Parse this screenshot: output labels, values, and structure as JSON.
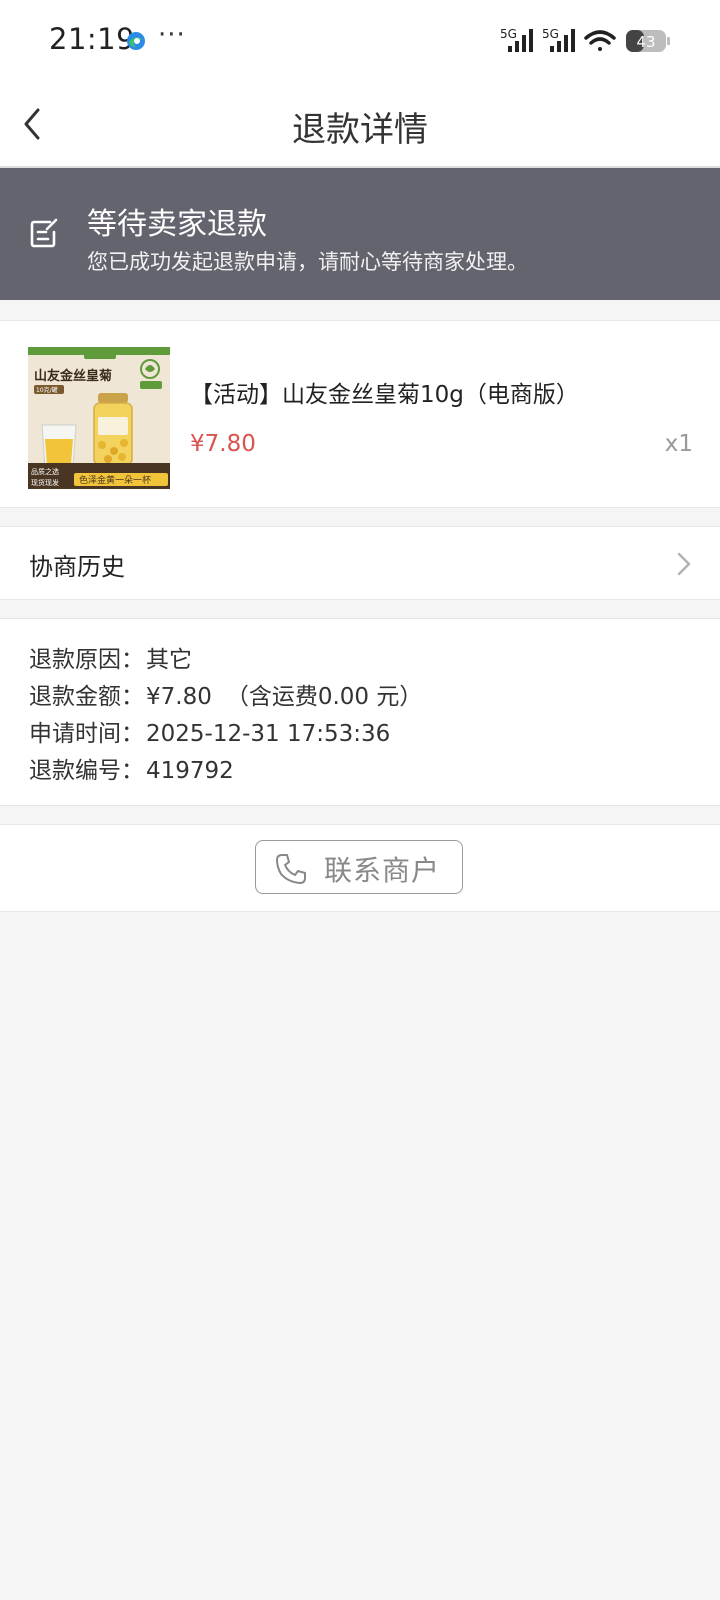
{
  "status_bar": {
    "time": "21:19",
    "more": "···",
    "signal1_label": "5G",
    "signal2_label": "5G",
    "battery": "43"
  },
  "header": {
    "title": "退款详情"
  },
  "banner": {
    "title": "等待卖家退款",
    "subtitle": "您已成功发起退款申请，请耐心等待商家处理。"
  },
  "product": {
    "name": "【活动】山友金丝皇菊10g（电商版）",
    "price": "¥7.80",
    "quantity": "x1",
    "image_text": {
      "brand": "山友金丝皇菊",
      "badge": "10克/罐",
      "tag1": "品质之选",
      "tag2": "现货现发",
      "slogan": "色泽金黄一朵一杯"
    }
  },
  "history": {
    "label": "协商历史"
  },
  "refund_info": {
    "reason_label": "退款原因：",
    "reason_value": "其它",
    "amount_label": "退款金额：",
    "amount_value": "¥7.80",
    "amount_note": "（含运费0.00 元）",
    "time_label": "申请时间：",
    "time_value": "2025-12-31 17:53:36",
    "number_label": "退款编号：",
    "number_value": "419792"
  },
  "contact": {
    "label": "联系商户"
  },
  "colors": {
    "banner_bg": "#63646e",
    "price": "#d9534f",
    "page_bg": "#f5f5f5"
  }
}
